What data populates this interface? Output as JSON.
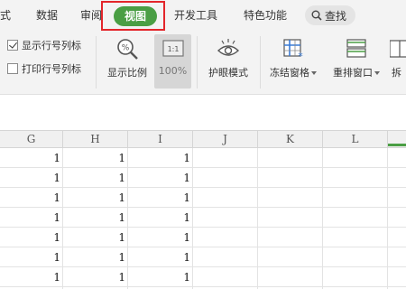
{
  "tabs": {
    "format_partial": "式",
    "data": "数据",
    "review_partial": "审阅",
    "view": "视图",
    "developer": "开发工具",
    "features": "特色功能",
    "search": "查找"
  },
  "ribbon": {
    "show_row_col_headers": {
      "label": "显示行号列标",
      "checked": true
    },
    "print_row_col_headers": {
      "label": "打印行号列标",
      "checked": false
    },
    "zoom_ratio": "显示比例",
    "zoom_100": "100%",
    "zoom_100_icon_text": "1:1",
    "eye_protection": "护眼模式",
    "freeze_panes": "冻结窗格",
    "rearrange_windows": "重排窗口",
    "split_partial": "拆"
  },
  "accent_color": "#4a9e44",
  "highlight_color": "#e3262b",
  "grid": {
    "columns": [
      "G",
      "H",
      "I",
      "J",
      "K",
      "L"
    ],
    "rows": [
      [
        "1",
        "1",
        "1",
        "",
        "",
        ""
      ],
      [
        "1",
        "1",
        "1",
        "",
        "",
        ""
      ],
      [
        "1",
        "1",
        "1",
        "",
        "",
        ""
      ],
      [
        "1",
        "1",
        "1",
        "",
        "",
        ""
      ],
      [
        "1",
        "1",
        "1",
        "",
        "",
        ""
      ],
      [
        "1",
        "1",
        "1",
        "",
        "",
        ""
      ],
      [
        "1",
        "1",
        "1",
        "",
        "",
        ""
      ]
    ]
  }
}
